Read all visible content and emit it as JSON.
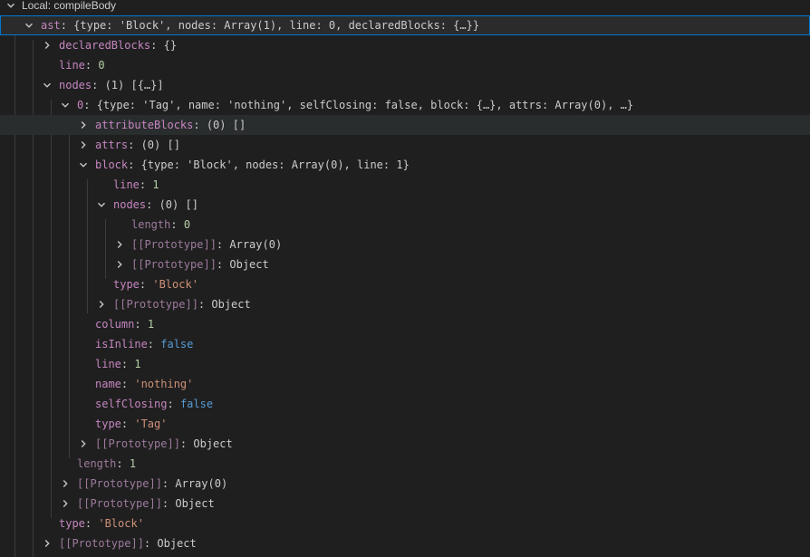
{
  "section": {
    "label": "Local: compileBody"
  },
  "rows": {
    "ast": {
      "key": "ast",
      "preview": "{type: 'Block', nodes: Array(1), line: 0, declaredBlocks: {…}}"
    },
    "declaredBlocks": {
      "key": "declaredBlocks",
      "preview": "{}"
    },
    "line0": {
      "key": "line",
      "value": "0"
    },
    "nodes": {
      "key": "nodes",
      "preview": "(1) [{…}]"
    },
    "n0": {
      "key": "0",
      "preview": "{type: 'Tag', name: 'nothing', selfClosing: false, block: {…}, attrs: Array(0), …}"
    },
    "attributeBlocks": {
      "key": "attributeBlocks",
      "preview": "(0) []"
    },
    "attrs": {
      "key": "attrs",
      "preview": "(0) []"
    },
    "block": {
      "key": "block",
      "preview": "{type: 'Block', nodes: Array(0), line: 1}"
    },
    "blockLine": {
      "key": "line",
      "value": "1"
    },
    "blockNodes": {
      "key": "nodes",
      "preview": "(0) []"
    },
    "blockNodesLength": {
      "key": "length",
      "value": "0"
    },
    "blockNodesProtoArr": {
      "key": "[[Prototype]]",
      "value": "Array(0)"
    },
    "blockNodesProtoObj": {
      "key": "[[Prototype]]",
      "value": "Object"
    },
    "blockType": {
      "key": "type",
      "value": "'Block'"
    },
    "blockProto": {
      "key": "[[Prototype]]",
      "value": "Object"
    },
    "column": {
      "key": "column",
      "value": "1"
    },
    "isInline": {
      "key": "isInline",
      "value": "false"
    },
    "n0Line": {
      "key": "line",
      "value": "1"
    },
    "name": {
      "key": "name",
      "value": "'nothing'"
    },
    "selfClosing": {
      "key": "selfClosing",
      "value": "false"
    },
    "n0Type": {
      "key": "type",
      "value": "'Tag'"
    },
    "n0Proto": {
      "key": "[[Prototype]]",
      "value": "Object"
    },
    "nodesLength": {
      "key": "length",
      "value": "1"
    },
    "nodesProtoArr": {
      "key": "[[Prototype]]",
      "value": "Array(0)"
    },
    "nodesProtoObj": {
      "key": "[[Prototype]]",
      "value": "Object"
    },
    "astType": {
      "key": "type",
      "value": "'Block'"
    },
    "astProto": {
      "key": "[[Prototype]]",
      "value": "Object"
    }
  },
  "colors": {
    "background": "#1f1f1f",
    "property": "#c586c0",
    "number": "#b5cea8",
    "string": "#ce9178",
    "boolean": "#569cd6",
    "selection_outline": "#0078d4"
  },
  "icons": {
    "expanded": "chevron-down-icon",
    "collapsed": "chevron-right-icon"
  }
}
